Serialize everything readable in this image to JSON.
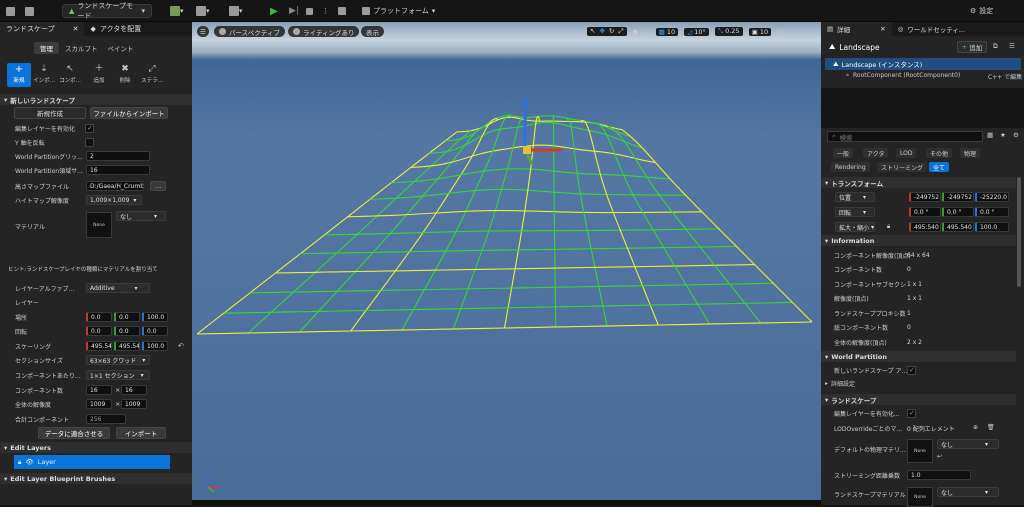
{
  "toolbar": {
    "mode_label": "ランドスケープモード",
    "platform_label": "プラットフォーム",
    "settings_label": "設定"
  },
  "left": {
    "tabs": [
      "ランドスケープ",
      "アクタを配置"
    ],
    "mode_tabs": [
      "管理",
      "スカルプト",
      "ペイント"
    ],
    "tools": [
      "新規",
      "インポ...",
      "コンポ...",
      "追加",
      "削除",
      "ステラ..."
    ],
    "section_new": "新しいランドスケープ",
    "create_new": "新規作成",
    "import_file": "ファイルからインポート",
    "rows": {
      "edit_layers": "編集レイヤーを有効化",
      "flip_y": "Y 軸を反転",
      "wp_grid": "World Partitionグリッ...",
      "wp_grid_val": "2",
      "wp_region": "World Partition領域サ...",
      "wp_region_val": "16",
      "heightmap_file": "高さマップファイル",
      "heightmap_path": "D:/Gaea/H_Crumb",
      "heightmap_res": "ハイトマップ解像度",
      "heightmap_res_val": "1,009×1,009",
      "material": "マテリアル",
      "material_thumb": "None",
      "material_val": "なし",
      "hint": "ヒント:ランドスケープレイヤの種類にマテリアルを割り当て",
      "layer_alpha": "レイヤーアルファブ...",
      "layer_alpha_val": "Additive",
      "layer": "レイヤー",
      "location": "場所",
      "loc": [
        "0.0",
        "0.0",
        "100.0"
      ],
      "rotation": "回転",
      "rot": [
        "0.0",
        "0.0",
        "0.0"
      ],
      "scale": "スケーリング",
      "scl": [
        "495.54",
        "495.54",
        "100.0"
      ],
      "section_size": "セクションサイズ",
      "section_size_val": "63×63 クワッド",
      "sections_per": "コンポーネントあたり...",
      "sections_per_val": "1×1 セクション",
      "comp_count": "コンポーネント数",
      "comp_count_val": [
        "16",
        "16"
      ],
      "total_res": "全体の解像度",
      "total_res_val": [
        "1009",
        "1009"
      ],
      "total_comp": "合計コンポーネント",
      "total_comp_val": "256"
    },
    "fit_data": "データに適合させる",
    "import": "インポート",
    "edit_layers_section": "Edit Layers",
    "layer_item": "Layer",
    "blueprint_brushes": "Edit Layer Blueprint Brushes"
  },
  "viewport": {
    "perspective": "パースペクティブ",
    "lit": "ライティングあり",
    "show": "表示",
    "grid_val": "10",
    "angle_val": "10°",
    "scale_val": "0.25",
    "cam_val": "10"
  },
  "right": {
    "tabs": [
      "詳細",
      "ワールドセッティ..."
    ],
    "actor_name": "Landscape",
    "add_label": "追加",
    "instance": "Landscape (インスタンス)",
    "root_comp": "RootComponent (RootComponent0)",
    "cpp_edit": "C++ で編集",
    "search_placeholder": "検索",
    "filters": [
      "一般",
      "アクタ",
      "LOD",
      "その他",
      "物理",
      "Rendering",
      "ストリーミング",
      "全て"
    ],
    "transform": "トランスフォーム",
    "t_loc": "位置",
    "t_loc_v": [
      "-249752",
      "-249752",
      "-25220.0"
    ],
    "t_rot": "回転",
    "t_rot_v": [
      "0.0 °",
      "0.0 °",
      "0.0 °"
    ],
    "t_scl": "拡大・縮小",
    "t_scl_v": [
      "495.540",
      "495.540",
      "100.0"
    ],
    "information": "Information",
    "info": [
      [
        "コンポーネント解像度(頂点)",
        "64 x 64"
      ],
      [
        "コンポーネント数",
        "0"
      ],
      [
        "コンポーネントサブセクシ",
        "1 x 1"
      ],
      [
        "解像度(頂点)",
        "1 x 1"
      ],
      [
        "ランドスケーププロキシ数",
        "1"
      ],
      [
        "総コンポーネント数",
        "0"
      ],
      [
        "全体の解像度(頂点)",
        "2 x 2"
      ]
    ],
    "world_partition": "World Partition",
    "new_landscape": "新しいランドスケープ ア...",
    "details_settings": "詳細設定",
    "landscape": "ランドスケープ",
    "edit_layers": "編集レイヤーを有効化...",
    "lod_override": "LODOverrideごとのマ...",
    "lod_override_val": "0 配列エレメント",
    "default_phys": "デフォルトの物理マテリ...",
    "default_phys_thumb": "None",
    "default_phys_val": "なし",
    "stream_dist": "ストリーミング距離乗数",
    "stream_dist_val": "1.0",
    "land_mat": "ランドスケープマテリアル",
    "land_mat_thumb": "None",
    "land_mat_val": "なし"
  }
}
